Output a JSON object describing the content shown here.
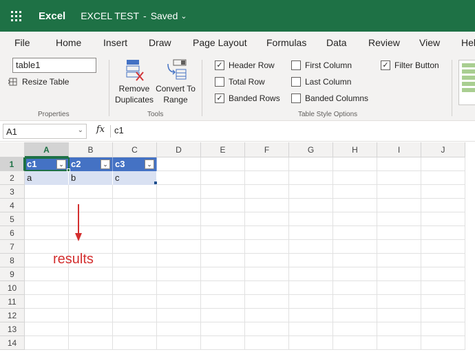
{
  "app": {
    "name": "Excel",
    "doc_title": "EXCEL TEST",
    "separator": "-",
    "status": "Saved"
  },
  "menu": {
    "tabs": [
      "File",
      "Home",
      "Insert",
      "Draw",
      "Page Layout",
      "Formulas",
      "Data",
      "Review",
      "View",
      "Help"
    ]
  },
  "ribbon": {
    "properties": {
      "table_name": "table1",
      "resize_label": "Resize Table",
      "group_label": "Properties"
    },
    "tools": {
      "remove_line1": "Remove",
      "remove_line2": "Duplicates",
      "convert_line1": "Convert To",
      "convert_line2": "Range",
      "group_label": "Tools"
    },
    "style_options": {
      "header_row": "Header Row",
      "total_row": "Total Row",
      "banded_rows": "Banded Rows",
      "first_column": "First Column",
      "last_column": "Last Column",
      "banded_columns": "Banded Columns",
      "filter_button": "Filter Button",
      "group_label": "Table Style Options",
      "checked": {
        "header_row": true,
        "total_row": false,
        "banded_rows": true,
        "first_column": false,
        "last_column": false,
        "banded_columns": false,
        "filter_button": true
      }
    }
  },
  "formula_bar": {
    "name_box": "A1",
    "fx": "fx",
    "value": "c1"
  },
  "sheet": {
    "columns": [
      "A",
      "B",
      "C",
      "D",
      "E",
      "F",
      "G",
      "H",
      "I",
      "J"
    ],
    "rows": [
      "1",
      "2",
      "3",
      "4",
      "5",
      "6",
      "7",
      "8",
      "9",
      "10",
      "11",
      "12",
      "13",
      "14"
    ],
    "table_headers": [
      "c1",
      "c2",
      "c3"
    ],
    "table_row": [
      "a",
      "b",
      "c"
    ]
  },
  "annotation": {
    "text": "results",
    "color": "#d32f2f"
  },
  "colors": {
    "brand": "#1e7145",
    "table_header": "#4472c4",
    "table_band": "#d9e1f2"
  }
}
